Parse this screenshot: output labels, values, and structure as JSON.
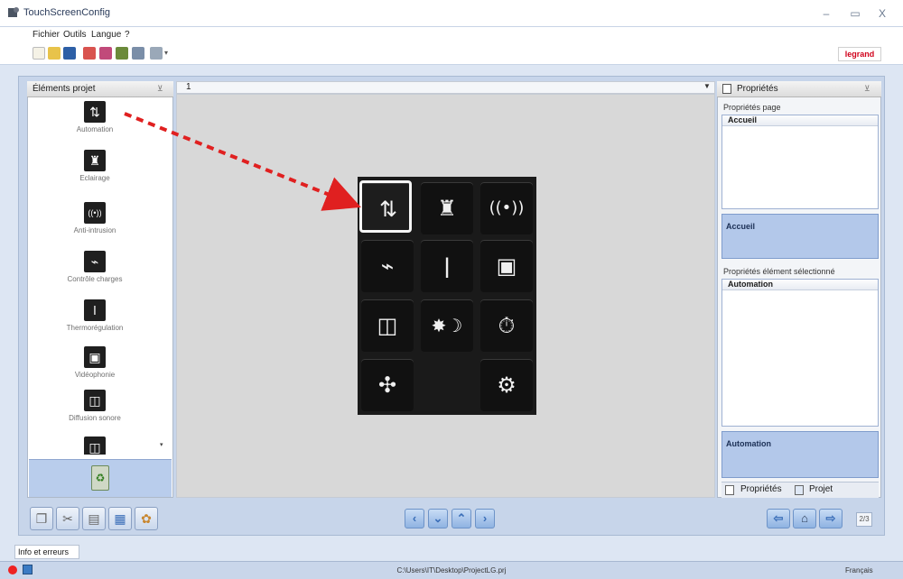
{
  "window": {
    "title": "TouchScreenConfig",
    "minimize": "–",
    "maximize": "▭",
    "close": "X"
  },
  "menu": {
    "items": [
      "Fichier",
      "Outils",
      "Langue",
      "?"
    ]
  },
  "toolbar": {
    "brand": "legrand"
  },
  "left_panel": {
    "title": "Éléments projet",
    "items": [
      {
        "label": "Automation",
        "icon": "blinds-icon"
      },
      {
        "label": "Eclairage",
        "icon": "lamp-icon"
      },
      {
        "label": "Anti-intrusion",
        "icon": "alarm-icon"
      },
      {
        "label": "Contrôle charges",
        "icon": "plug-icon"
      },
      {
        "label": "Thermorégulation",
        "icon": "thermometer-icon"
      },
      {
        "label": "Vidéophonie",
        "icon": "videophone-icon"
      },
      {
        "label": "Diffusion sonore",
        "icon": "speaker-icon"
      }
    ]
  },
  "page": {
    "number": "1"
  },
  "grid_cells": [
    {
      "icon": "blinds-icon",
      "glyph": "⇅"
    },
    {
      "icon": "lamp-icon",
      "glyph": "♜"
    },
    {
      "icon": "alarm-icon",
      "glyph": "((•))"
    },
    {
      "icon": "plug-icon",
      "glyph": "⌁"
    },
    {
      "icon": "thermometer-icon",
      "glyph": "🌡"
    },
    {
      "icon": "videophone-icon",
      "glyph": "▣"
    },
    {
      "icon": "speaker-icon",
      "glyph": "◫"
    },
    {
      "icon": "scenario-icon",
      "glyph": "✸☽"
    },
    {
      "icon": "timer-scenario-icon",
      "glyph": "⏱"
    },
    {
      "icon": "fan-icon",
      "glyph": "✣"
    },
    {
      "icon": "settings-icon",
      "glyph": "⚙"
    }
  ],
  "right_panel": {
    "title": "Propriétés",
    "page_props_caption": "Propriétés page",
    "page_props_head": "Accueil",
    "page_props_value": "Accueil",
    "element_props_caption": "Propriétés élément sélectionné",
    "element_props_head": "Automation",
    "element_props_value": "Automation",
    "tab_properties": "Propriétés",
    "tab_project": "Projet"
  },
  "bottom": {
    "page_counter": "2/3"
  },
  "info_tab": "Info et erreurs",
  "status": {
    "path": "C:\\Users\\IT\\Desktop\\ProjectLG.prj",
    "language": "Français"
  }
}
